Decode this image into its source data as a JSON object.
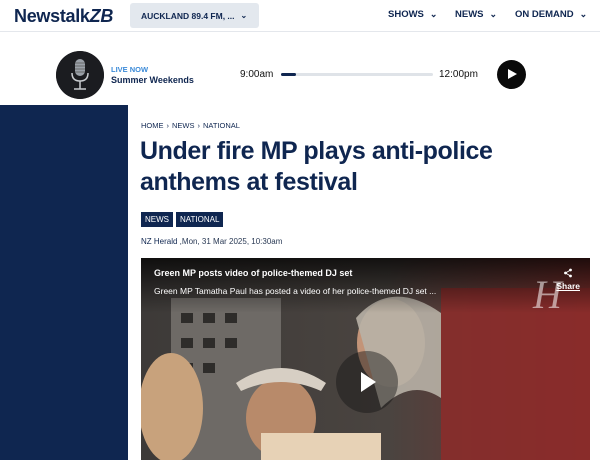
{
  "brand": {
    "name": "Newstalk",
    "suffix": "ZB"
  },
  "station_selector": {
    "label": "AUCKLAND 89.4 FM, ...",
    "chevron": "chevron-down-icon"
  },
  "nav": [
    {
      "label": "SHOWS"
    },
    {
      "label": "NEWS"
    },
    {
      "label": "ON DEMAND"
    }
  ],
  "player": {
    "live_label": "LIVE NOW",
    "show_name": "Summer Weekends",
    "start_time": "9:00am",
    "end_time": "12:00pm",
    "progress_fraction": 0.1
  },
  "breadcrumb": [
    "HOME",
    "NEWS",
    "NATIONAL"
  ],
  "article": {
    "headline": "Under fire MP plays anti-police anthems at festival",
    "tags": [
      "NEWS",
      "NATIONAL"
    ],
    "source": "NZ Herald",
    "date": " ,Mon, 31 Mar 2025, 10:30am"
  },
  "video": {
    "title": "Green MP posts video of police-themed DJ set",
    "description": "Green MP Tamatha Paul has posted a video of her police-themed DJ set ...",
    "share_label": "Share"
  },
  "colors": {
    "brand_navy": "#0f2650",
    "live_blue": "#3b8ad8"
  }
}
